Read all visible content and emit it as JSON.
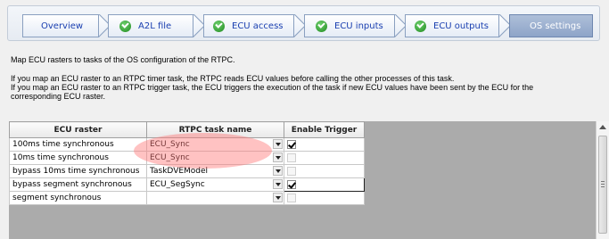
{
  "wizard": {
    "steps": [
      {
        "label": "Overview",
        "completed": false,
        "active": false
      },
      {
        "label": "A2L file",
        "completed": true,
        "active": false
      },
      {
        "label": "ECU access",
        "completed": true,
        "active": false
      },
      {
        "label": "ECU inputs",
        "completed": true,
        "active": false
      },
      {
        "label": "ECU outputs",
        "completed": true,
        "active": false
      },
      {
        "label": "OS settings",
        "completed": false,
        "active": true
      }
    ]
  },
  "description": {
    "line1": "Map ECU rasters to tasks of the OS configuration of the RTPC.",
    "line2": "If you map an ECU raster to an RTPC timer task, the RTPC reads ECU values before calling the other processes of this task.",
    "line3": "If you map an ECU raster to an RTPC trigger task, the ECU triggers the execution of the task if new ECU values have been sent by the ECU for the",
    "line4": "corresponding ECU raster."
  },
  "table": {
    "headers": [
      "ECU raster",
      "RTPC task name",
      "Enable Trigger"
    ],
    "rows": [
      {
        "raster": "100ms time synchronous",
        "task": "ECU_Sync",
        "trigger": true,
        "trigger_enabled": true
      },
      {
        "raster": "10ms time synchronous",
        "task": "ECU_Sync",
        "trigger": false,
        "trigger_enabled": false
      },
      {
        "raster": "bypass 10ms time synchronous",
        "task": "TaskDVEModel",
        "trigger": false,
        "trigger_enabled": false
      },
      {
        "raster": "bypass segment synchronous",
        "task": "ECU_SegSync",
        "trigger": true,
        "trigger_enabled": true
      },
      {
        "raster": "segment synchronous",
        "task": "",
        "trigger": false,
        "trigger_enabled": false
      }
    ]
  },
  "colors": {
    "highlight": "#ff7878",
    "active_step": "#8ea4c8",
    "link_text": "#1a3fb0"
  }
}
